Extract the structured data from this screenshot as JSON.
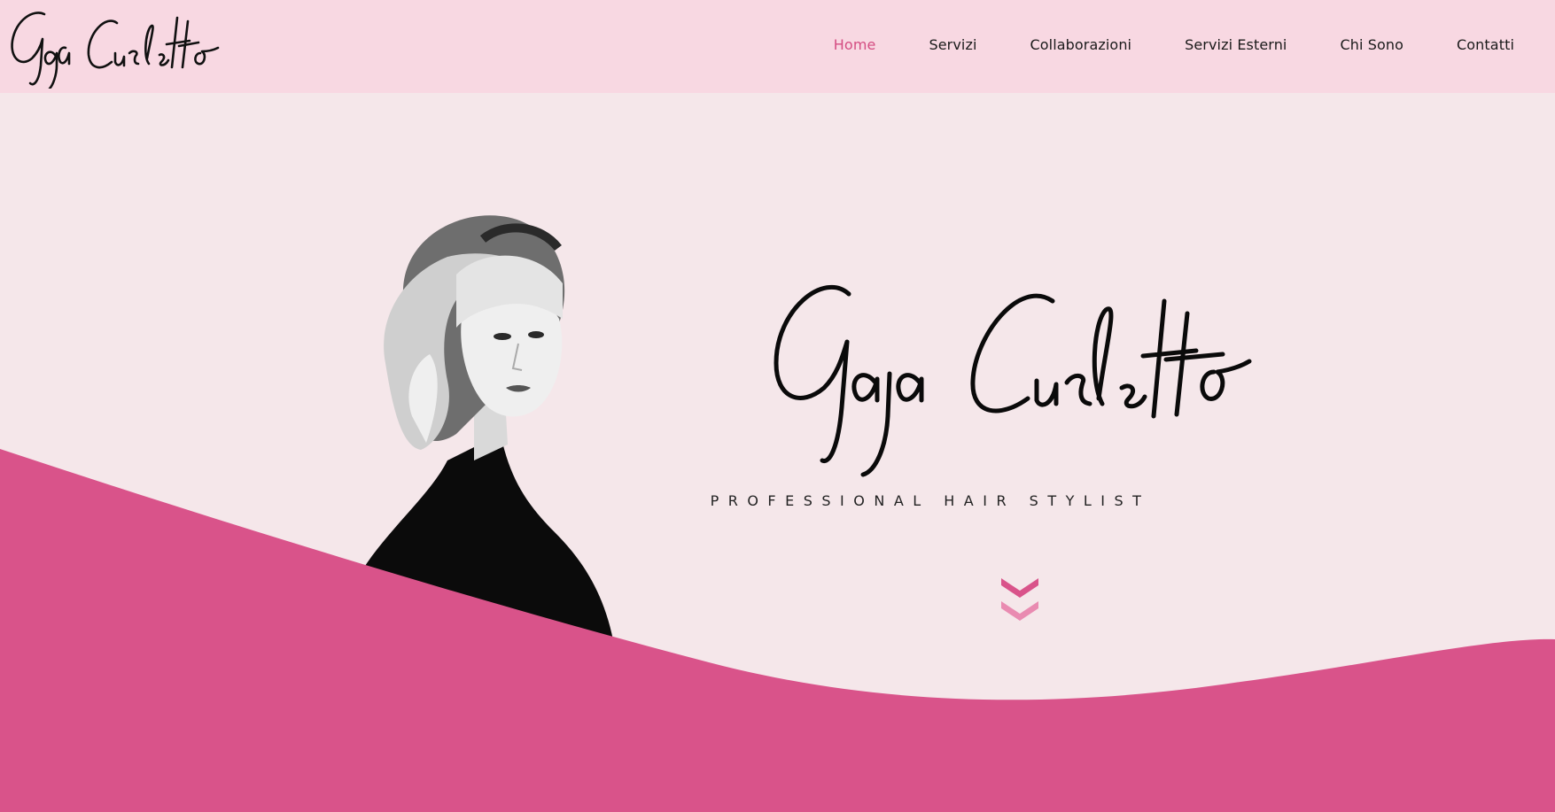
{
  "brand": {
    "name": "Gaja Curletto",
    "accent_color": "#d9538a",
    "header_bg": "#f8d8e2",
    "hero_bg": "#f5e7ea"
  },
  "nav": {
    "items": [
      {
        "label": "Home",
        "active": true
      },
      {
        "label": "Servizi",
        "active": false
      },
      {
        "label": "Collaborazioni",
        "active": false
      },
      {
        "label": "Servizi Esterni",
        "active": false
      },
      {
        "label": "Chi Sono",
        "active": false
      },
      {
        "label": "Contatti",
        "active": false
      }
    ]
  },
  "hero": {
    "signature": "Gaja Curletto",
    "tagline": "PROFESSIONAL HAIR STYLIST",
    "scroll_icon": "double-chevron-down-icon"
  }
}
